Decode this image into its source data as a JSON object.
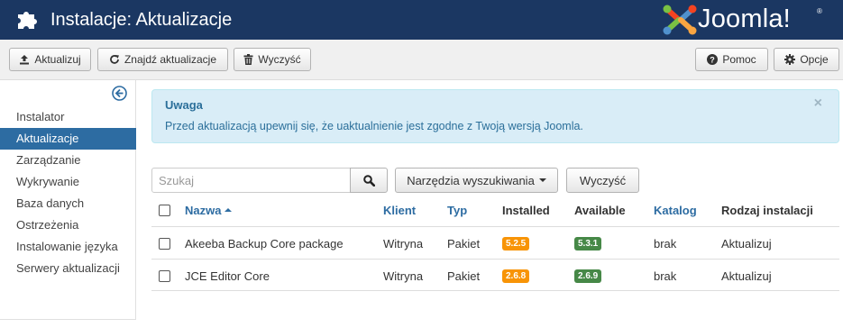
{
  "header": {
    "title": "Instalacje: Aktualizacje",
    "logo_text": "Joomla!",
    "logo_reg": "®"
  },
  "toolbar": {
    "update_label": "Aktualizuj",
    "find_updates_label": "Znajdź aktualizacje",
    "clear_label": "Wyczyść",
    "help_label": "Pomoc",
    "options_label": "Opcje"
  },
  "sidebar": {
    "items": [
      {
        "label": "Instalator",
        "active": false
      },
      {
        "label": "Aktualizacje",
        "active": true
      },
      {
        "label": "Zarządzanie",
        "active": false
      },
      {
        "label": "Wykrywanie",
        "active": false
      },
      {
        "label": "Baza danych",
        "active": false
      },
      {
        "label": "Ostrzeżenia",
        "active": false
      },
      {
        "label": "Instalowanie języka",
        "active": false
      },
      {
        "label": "Serwery aktualizacji",
        "active": false
      }
    ]
  },
  "alert": {
    "title": "Uwaga",
    "message": "Przed aktualizacją upewnij się, że uaktualnienie jest zgodne z Twoją wersją Joomla.",
    "close": "×"
  },
  "search": {
    "placeholder": "Szukaj",
    "value": "",
    "tools_label": "Narzędzia wyszukiwania",
    "clear_label": "Wyczyść"
  },
  "table": {
    "columns": {
      "name": "Nazwa",
      "client": "Klient",
      "type": "Typ",
      "installed": "Installed",
      "available": "Available",
      "folder": "Katalog",
      "install_type": "Rodzaj instalacji"
    },
    "rows": [
      {
        "name": "Akeeba Backup Core package",
        "client": "Witryna",
        "type": "Pakiet",
        "installed": "5.2.5",
        "available": "5.3.1",
        "folder": "brak",
        "install_type": "Aktualizuj"
      },
      {
        "name": "JCE Editor Core",
        "client": "Witryna",
        "type": "Pakiet",
        "installed": "2.6.8",
        "available": "2.6.9",
        "folder": "brak",
        "install_type": "Aktualizuj"
      }
    ]
  },
  "colors": {
    "header_bg": "#1b3762",
    "active_nav": "#2d6ca2",
    "badge_installed": "#f89406",
    "badge_available": "#468847"
  }
}
